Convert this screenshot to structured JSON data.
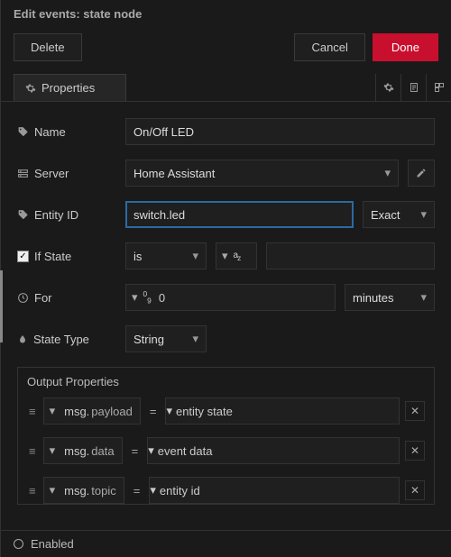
{
  "title": "Edit events: state node",
  "buttons": {
    "delete": "Delete",
    "cancel": "Cancel",
    "done": "Done"
  },
  "tab": {
    "label": "Properties"
  },
  "fields": {
    "name": {
      "label": "Name",
      "value": "On/Off LED"
    },
    "server": {
      "label": "Server",
      "value": "Home Assistant"
    },
    "entity": {
      "label": "Entity ID",
      "value": "switch.led",
      "match": "Exact"
    },
    "ifstate": {
      "label": "If State",
      "op": "is"
    },
    "for": {
      "label": "For",
      "value": "0",
      "unit": "minutes"
    },
    "statetype": {
      "label": "State Type",
      "value": "String"
    }
  },
  "outputs": {
    "legend": "Output Properties",
    "prefix": "msg.",
    "rows": [
      {
        "prop": "payload",
        "val": "entity state"
      },
      {
        "prop": "data",
        "val": "event data"
      },
      {
        "prop": "topic",
        "val": "entity id"
      }
    ]
  },
  "footer": {
    "enabled": "Enabled"
  }
}
